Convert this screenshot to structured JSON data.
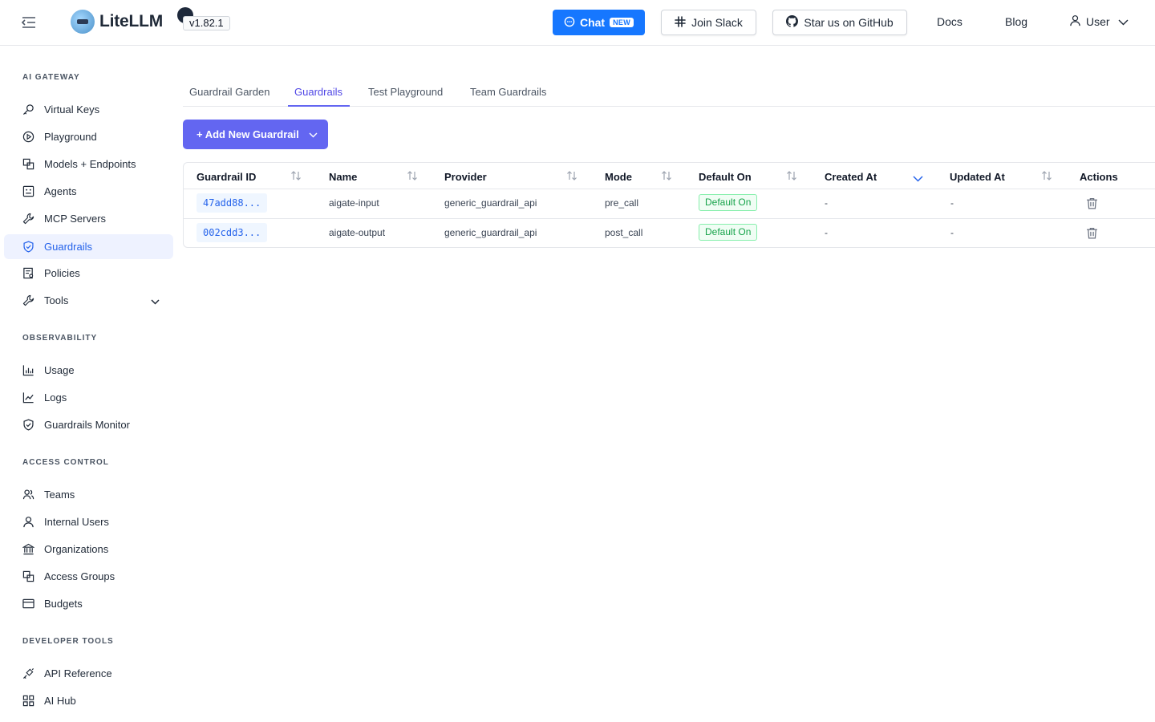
{
  "header": {
    "app_name": "LiteLLM",
    "version": "v1.82.1",
    "chat_label": "Chat",
    "chat_badge": "NEW",
    "slack_label": "Join Slack",
    "github_label": "Star us on GitHub",
    "docs_label": "Docs",
    "blog_label": "Blog",
    "user_label": "User"
  },
  "sidebar": {
    "sections": [
      {
        "title": "AI GATEWAY"
      },
      {
        "title": "OBSERVABILITY"
      },
      {
        "title": "ACCESS CONTROL"
      },
      {
        "title": "DEVELOPER TOOLS"
      }
    ],
    "items": [
      {
        "label": "Virtual Keys",
        "icon": "key-icon"
      },
      {
        "label": "Playground",
        "icon": "play-circle-icon"
      },
      {
        "label": "Models + Endpoints",
        "icon": "blocks-icon"
      },
      {
        "label": "Agents",
        "icon": "robot-icon"
      },
      {
        "label": "MCP Servers",
        "icon": "wrench-icon"
      },
      {
        "label": "Guardrails",
        "icon": "shield-check-icon",
        "active": true
      },
      {
        "label": "Policies",
        "icon": "policy-doc-icon"
      },
      {
        "label": "Tools",
        "icon": "tool-icon"
      },
      {
        "label": "Usage",
        "icon": "bar-chart-icon"
      },
      {
        "label": "Logs",
        "icon": "line-chart-icon"
      },
      {
        "label": "Guardrails Monitor",
        "icon": "shield-check-icon"
      },
      {
        "label": "Teams",
        "icon": "team-icon"
      },
      {
        "label": "Internal Users",
        "icon": "user-icon"
      },
      {
        "label": "Organizations",
        "icon": "bank-icon"
      },
      {
        "label": "Access Groups",
        "icon": "block-group-icon"
      },
      {
        "label": "Budgets",
        "icon": "wallet-icon"
      },
      {
        "label": "API Reference",
        "icon": "api-icon"
      },
      {
        "label": "AI Hub",
        "icon": "app-grid-icon"
      }
    ]
  },
  "tabs": [
    {
      "label": "Guardrail Garden"
    },
    {
      "label": "Guardrails",
      "active": true
    },
    {
      "label": "Test Playground"
    },
    {
      "label": "Team Guardrails"
    }
  ],
  "add_button_label": "+ Add New Guardrail",
  "table": {
    "columns": [
      "Guardrail ID",
      "Name",
      "Provider",
      "Mode",
      "Default On",
      "Created At",
      "Updated At",
      "Actions"
    ],
    "sorted_column": "Created At",
    "rows": [
      {
        "id": "47add88...",
        "name": "aigate-input",
        "provider": "generic_guardrail_api",
        "mode": "pre_call",
        "default_on": "Default On",
        "created_at": "-",
        "updated_at": "-"
      },
      {
        "id": "002cdd3...",
        "name": "aigate-output",
        "provider": "generic_guardrail_api",
        "mode": "post_call",
        "default_on": "Default On",
        "created_at": "-",
        "updated_at": "-"
      }
    ]
  },
  "colors": {
    "primary": "#1677ff",
    "accent": "#6366f1",
    "active_bg": "#eef2ff",
    "success": "#16a34a"
  }
}
